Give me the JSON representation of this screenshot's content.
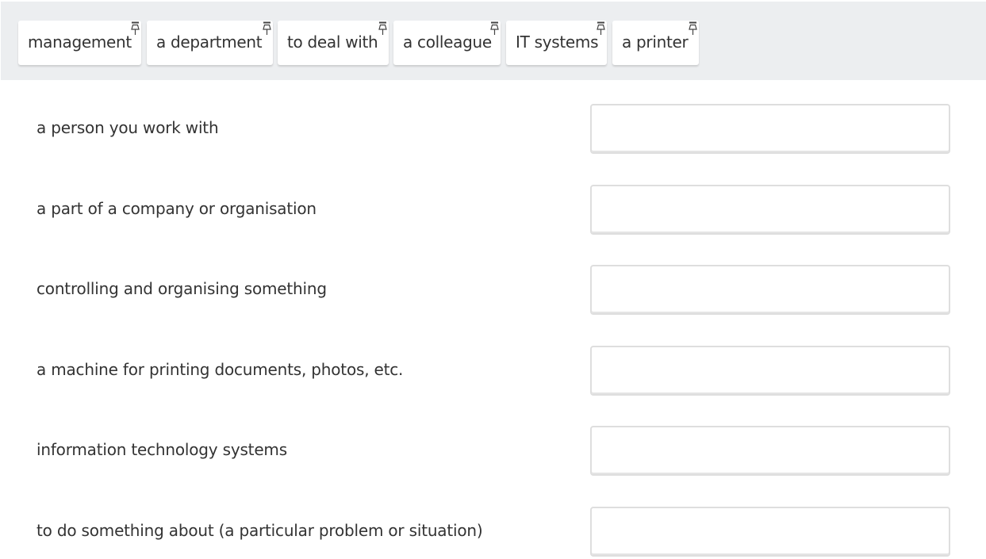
{
  "word_bank": {
    "items": [
      {
        "label": "management"
      },
      {
        "label": "a department"
      },
      {
        "label": "to deal with"
      },
      {
        "label": "a colleague"
      },
      {
        "label": "IT systems"
      },
      {
        "label": "a printer"
      }
    ]
  },
  "definitions": [
    {
      "text": "a person you work with",
      "answer": ""
    },
    {
      "text": "a part of a company or organisation",
      "answer": ""
    },
    {
      "text": "controlling and organising something",
      "answer": ""
    },
    {
      "text": "a machine for printing documents, photos, etc.",
      "answer": ""
    },
    {
      "text": "information technology systems",
      "answer": ""
    },
    {
      "text": "to do something about (a particular problem or situation)",
      "answer": ""
    }
  ],
  "icons": {
    "chip_icon": "pin-icon"
  },
  "colors": {
    "word_bank_bg": "#eceef0",
    "chip_bg": "#ffffff",
    "text": "#333333",
    "drop_zone_border": "#dedede"
  }
}
